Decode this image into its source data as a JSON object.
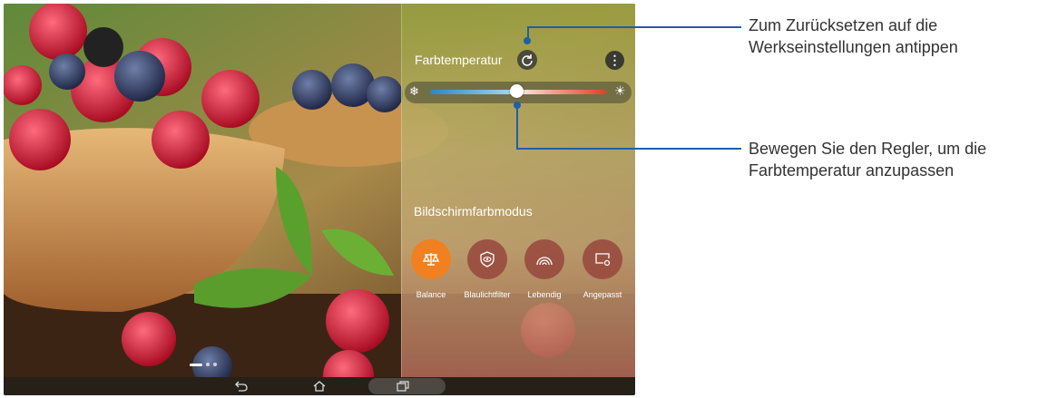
{
  "panel": {
    "color_temp_title": "Farbtemperatur",
    "mode_title": "Bildschirmfarbmodus",
    "slider_value_percent": 49,
    "modes": [
      {
        "label": "Balance",
        "icon": "balance-scale-icon",
        "selected": true
      },
      {
        "label": "Blaulichtfilter",
        "icon": "eye-shield-icon",
        "selected": false
      },
      {
        "label": "Lebendig",
        "icon": "rainbow-icon",
        "selected": false
      },
      {
        "label": "Angepasst",
        "icon": "custom-screen-icon",
        "selected": false
      }
    ]
  },
  "callouts": {
    "reset_line1": "Zum Zurücksetzen auf die",
    "reset_line2": "Werkseinstellungen antippen",
    "slider_line1": "Bewegen Sie den Regler, um die",
    "slider_line2": "Farbtemperatur anzupassen"
  },
  "colors": {
    "accent_orange": "#f08020",
    "callout_blue": "#1f5fa8"
  },
  "nav": {
    "back_icon": "back-icon",
    "home_icon": "home-icon",
    "recents_icon": "recents-icon"
  }
}
